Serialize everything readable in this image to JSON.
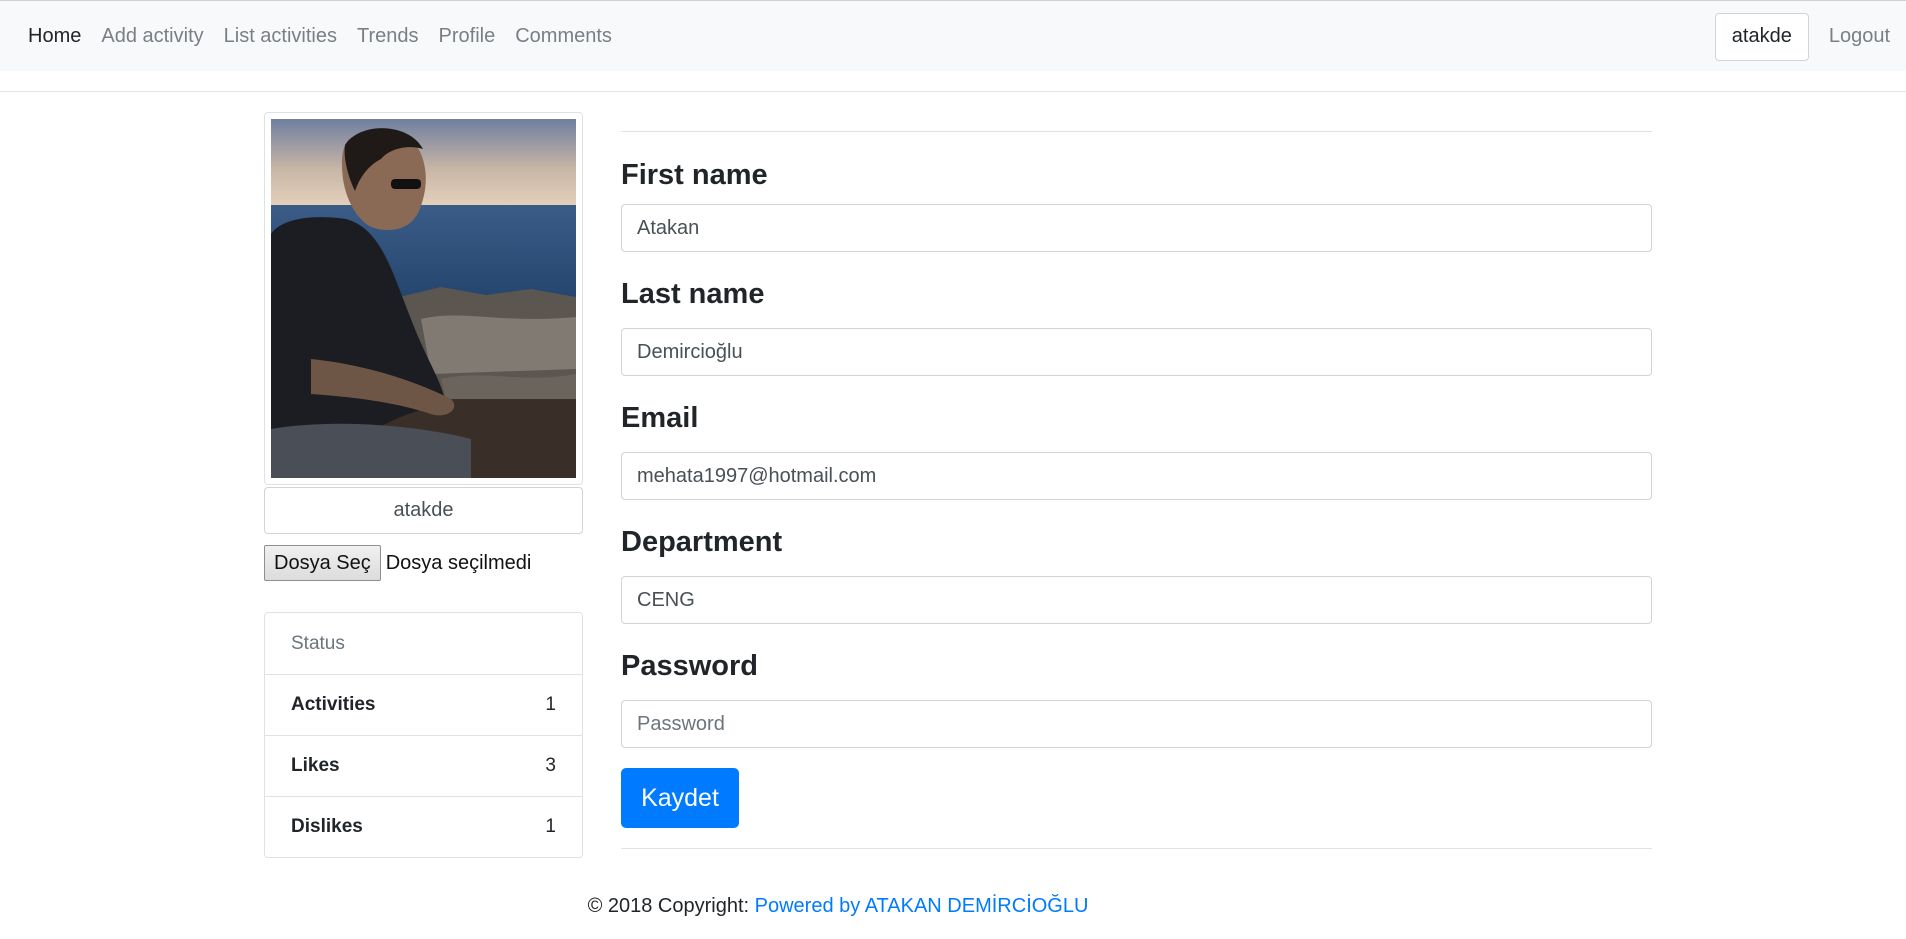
{
  "nav": {
    "links": [
      "Home",
      "Add activity",
      "List activities",
      "Trends",
      "Profile",
      "Comments"
    ],
    "user": "atakde",
    "logout": "Logout"
  },
  "profile": {
    "username": "atakde",
    "file_button": "Dosya Seç",
    "file_status": "Dosya seçilmedi"
  },
  "stats": {
    "heading": "Status",
    "rows": [
      {
        "label": "Activities",
        "value": "1"
      },
      {
        "label": "Likes",
        "value": "3"
      },
      {
        "label": "Dislikes",
        "value": "1"
      }
    ]
  },
  "form": {
    "first_name_label": "First name",
    "first_name_value": "Atakan",
    "last_name_label": "Last name",
    "last_name_value": "Demircioğlu",
    "email_label": "Email",
    "email_value": "mehata1997@hotmail.com",
    "department_label": "Department",
    "department_value": "CENG",
    "password_label": "Password",
    "password_placeholder": "Password",
    "save_label": "Kaydet"
  },
  "footer": {
    "text": "© 2018 Copyright: ",
    "link": "Powered by ATAKAN DEMİRCİOĞLU"
  },
  "colors": {
    "accent": "#007bff",
    "navbar_bg": "#f8f9fa"
  }
}
